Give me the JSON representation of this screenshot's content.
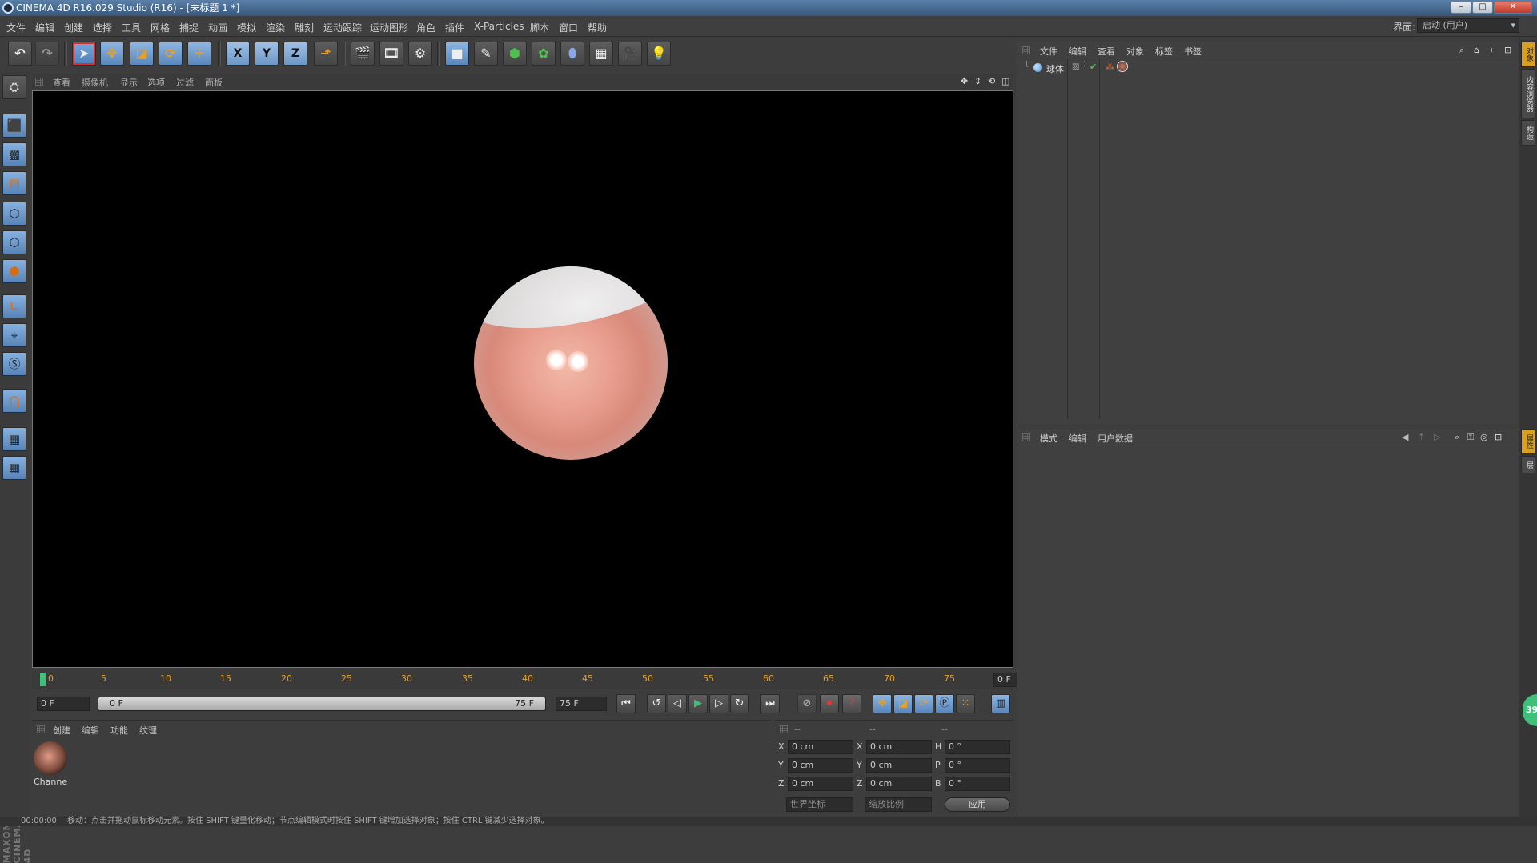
{
  "window": {
    "title": "CINEMA 4D R16.029 Studio (R16) - [未标题 1 *]",
    "minimize": "–",
    "maximize": "□",
    "close": "✕"
  },
  "menu": {
    "items": [
      "文件",
      "编辑",
      "创建",
      "选择",
      "工具",
      "网格",
      "捕捉",
      "动画",
      "模拟",
      "渲染",
      "雕刻",
      "运动跟踪",
      "运动图形",
      "角色",
      "插件",
      "X-Particles",
      "脚本",
      "窗口",
      "帮助"
    ],
    "interface_label": "界面:",
    "interface_value": "启动 (用户)"
  },
  "toolbar": {
    "undo": "undo-icon",
    "redo": "redo-icon",
    "axis_x": "X",
    "axis_y": "Y",
    "axis_z": "Z"
  },
  "viewport": {
    "menu": [
      "查看",
      "摄像机",
      "显示",
      "选项",
      "过滤",
      "面板"
    ]
  },
  "timeline": {
    "ticks": [
      "0",
      "5",
      "10",
      "15",
      "20",
      "25",
      "30",
      "35",
      "40",
      "45",
      "50",
      "55",
      "60",
      "65",
      "70",
      "75"
    ],
    "current_frame": "0 F"
  },
  "transport": {
    "start_field": "0 F",
    "range_start": "0 F",
    "range_end": "75 F",
    "end_field": "75 F"
  },
  "material_manager": {
    "menu": [
      "创建",
      "编辑",
      "功能",
      "纹理"
    ],
    "material_name": "Channe"
  },
  "coord_manager": {
    "headers": [
      "--",
      "--",
      "--"
    ],
    "rows": [
      {
        "a": "X",
        "v1": "0 cm",
        "b": "X",
        "v2": "0 cm",
        "c": "H",
        "v3": "0 °"
      },
      {
        "a": "Y",
        "v1": "0 cm",
        "b": "Y",
        "v2": "0 cm",
        "c": "P",
        "v3": "0 °"
      },
      {
        "a": "Z",
        "v1": "0 cm",
        "b": "Z",
        "v2": "0 cm",
        "c": "B",
        "v3": "0 °"
      }
    ],
    "coord_select": "世界坐标",
    "scale_select": "缩放比例",
    "apply": "应用"
  },
  "object_manager": {
    "menu": [
      "文件",
      "编辑",
      "查看",
      "对象",
      "标签",
      "书签"
    ],
    "object_name": "球体"
  },
  "attribute_manager": {
    "menu": [
      "模式",
      "编辑",
      "用户数据"
    ]
  },
  "right_tabs": [
    "对象",
    "内容浏览器",
    "构造",
    "属性",
    "层"
  ],
  "brand": "MAXON CINEMA 4D",
  "status": {
    "time": "00:00:00",
    "message": "移动：点击并拖动鼠标移动元素。按住 SHIFT 键量化移动；节点编辑模式时按住 SHIFT 键增加选择对象；按住 CTRL 键减少选择对象。"
  },
  "badge": "39"
}
